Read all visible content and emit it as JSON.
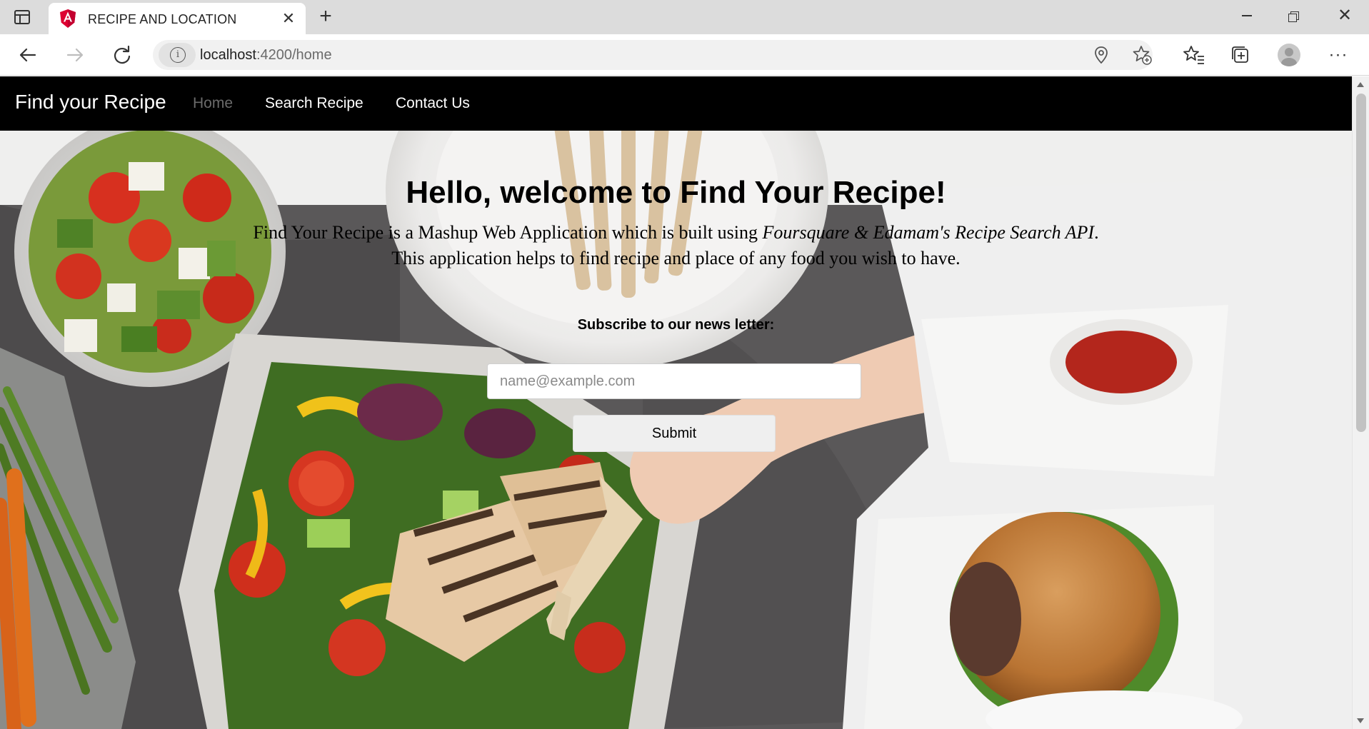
{
  "browser": {
    "tab_title": "RECIPE AND LOCATION",
    "url_host": "localhost",
    "url_path": ":4200/home",
    "new_tab_symbol": "+",
    "close_symbol": "✕"
  },
  "navbar": {
    "brand": "Find your Recipe",
    "links": [
      "Home",
      "Search Recipe",
      "Contact Us"
    ],
    "active": "Home"
  },
  "hero": {
    "title_prefix": "Hello, welcome to ",
    "title_bold": "Find Your Recipe!",
    "desc_line1_prefix": "Find Your Recipe is a Mashup Web Application which is built using ",
    "desc_line1_italic": "Foursquare & Edamam's Recipe Search API",
    "desc_line1_suffix": ".",
    "desc_line2": "This application helps to find recipe and place of any food you wish to have."
  },
  "newsletter": {
    "label": "Subscribe to our news letter:",
    "placeholder": "name@example.com",
    "value": "",
    "submit_label": "Submit"
  },
  "colors": {
    "navbar_bg": "#000000",
    "nav_active": "#6b6b6b",
    "tabbar_bg": "#dcdcdc"
  },
  "icons": [
    "tab-actions-icon",
    "angular-logo-icon",
    "close-icon",
    "new-tab-icon",
    "minimize-icon",
    "restore-icon",
    "window-close-icon",
    "back-icon",
    "forward-icon",
    "reload-icon",
    "info-icon",
    "location-icon",
    "add-favorite-icon",
    "favorites-icon",
    "collections-icon",
    "profile-icon",
    "more-icon"
  ]
}
